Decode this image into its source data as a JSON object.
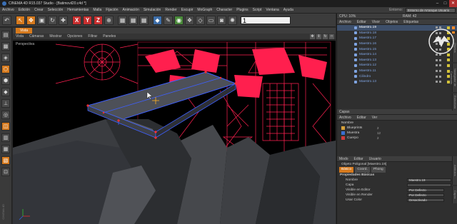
{
  "window": {
    "title": "CINEMA 4D R15.037 Studio - [Batimovil20.c4d *]",
    "controls": [
      "–",
      "□",
      "✕"
    ]
  },
  "menubar": {
    "items": [
      "Archivo",
      "Edición",
      "Crear",
      "Selección",
      "Herramientas",
      "Malla",
      "Fijación",
      "Animación",
      "Simulación",
      "Render",
      "Escupir",
      "MoGraph",
      "Character",
      "Plugins",
      "Script",
      "Ventana",
      "Ayuda"
    ],
    "layout_label": "Entorno:",
    "layout_value": "Entorno de Arranque Usuario"
  },
  "toolbar": {
    "axis_x": "X",
    "axis_y": "Y",
    "axis_z": "Z",
    "number_field": "1"
  },
  "viewport": {
    "tab": "Vista",
    "menu": [
      "Vista",
      "Cámaras",
      "Mostrar",
      "Opciones",
      "Filtrar",
      "Paneles"
    ],
    "camera_label": "Perspectiva"
  },
  "object_manager": {
    "menu": [
      "Archivo",
      "Editar",
      "Visor",
      "Objetos",
      "Etiquetas"
    ],
    "stats": "CPU: 10%",
    "ram": "RAM: 42",
    "rows": [
      {
        "label": "Maestro.19",
        "selected": true
      },
      {
        "label": "Maestro.18",
        "selected": false
      },
      {
        "label": "Maestro.17",
        "selected": false
      },
      {
        "label": "Maestro.16",
        "selected": false
      },
      {
        "label": "Maestro.15",
        "selected": false
      },
      {
        "label": "Maestro.14",
        "selected": false
      },
      {
        "label": "Maestro.13",
        "selected": false
      },
      {
        "label": "Maestro.12",
        "selected": false
      },
      {
        "label": "Maestro.11",
        "selected": false
      },
      {
        "label": "Cilindro",
        "selected": false
      },
      {
        "label": "Maestro.13",
        "selected": false
      }
    ]
  },
  "layers": {
    "title": "Capas",
    "menu": [
      "Archivo",
      "Editar",
      "Ver"
    ],
    "name_header": "Nombre",
    "rows": [
      {
        "label": "Blueprints",
        "count": "2",
        "color": "#d6a13a"
      },
      {
        "label": "Muestra",
        "count": "12",
        "color": "#3a6fd0"
      },
      {
        "label": "Cuerpo",
        "count": "2",
        "color": "#d03a3a"
      }
    ]
  },
  "attributes": {
    "menu": [
      "Modo",
      "Editar",
      "Usuario"
    ],
    "object_title": "Objeto Poligonal [Maestro.19]",
    "tabs": [
      "Básico",
      "Coord.",
      "Phong"
    ],
    "section": "Propiedades Básicas",
    "fields": [
      {
        "label": "Nombre",
        "value": "Maestro.19"
      },
      {
        "label": "Capa",
        "value": ""
      },
      {
        "label": "Visible en Editor",
        "value": "Por Defecto"
      },
      {
        "label": "Visible en Render",
        "value": "Por Defecto"
      },
      {
        "label": "Usar Color",
        "value": "Desactivado"
      }
    ]
  },
  "side_tabs": [
    "Objetos",
    "Navegador de Contenido",
    "Estructura",
    "Atributos",
    "Capas"
  ],
  "left_brand": "CINEMA 4D"
}
